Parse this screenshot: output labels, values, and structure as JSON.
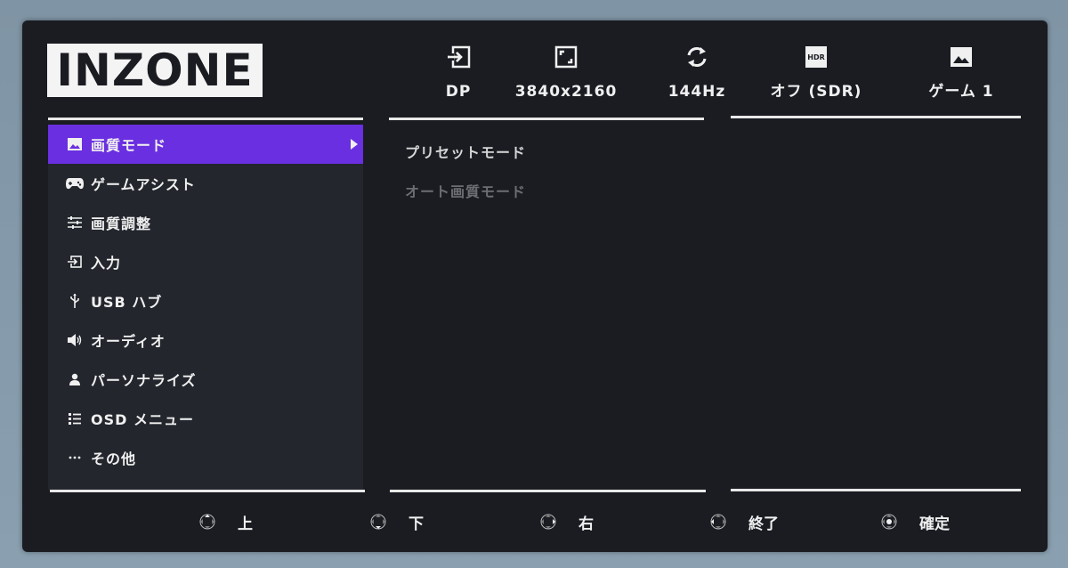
{
  "brand": {
    "logo_text": "INZONE"
  },
  "status": [
    {
      "icon": "input-icon",
      "label": "DP"
    },
    {
      "icon": "resolution-icon",
      "label": "3840x2160"
    },
    {
      "icon": "refresh-rate-icon",
      "label": "144Hz"
    },
    {
      "icon": "hdr-icon",
      "icon_text": "HDR",
      "label": "オフ (SDR)"
    },
    {
      "icon": "picture-mode-icon",
      "label": "ゲーム 1"
    }
  ],
  "menu": {
    "items": [
      {
        "icon": "picture-icon",
        "label": "画質モード",
        "active": true
      },
      {
        "icon": "gamepad-icon",
        "label": "ゲームアシスト"
      },
      {
        "icon": "sliders-icon",
        "label": "画質調整"
      },
      {
        "icon": "input-icon",
        "label": "入力"
      },
      {
        "icon": "usb-icon",
        "label": "USB ハブ"
      },
      {
        "icon": "speaker-icon",
        "label": "オーディオ"
      },
      {
        "icon": "person-icon",
        "label": "パーソナライズ"
      },
      {
        "icon": "list-icon",
        "label": "OSD メニュー"
      },
      {
        "icon": "ellipsis-icon",
        "label": "その他"
      }
    ]
  },
  "submenu": {
    "items": [
      {
        "label": "プリセットモード",
        "enabled": true
      },
      {
        "label": "オート画質モード",
        "enabled": false
      }
    ]
  },
  "footer": [
    {
      "icon": "dpad-up-icon",
      "label": "上"
    },
    {
      "icon": "dpad-down-icon",
      "label": "下"
    },
    {
      "icon": "dpad-right-icon",
      "label": "右"
    },
    {
      "icon": "dpad-left-icon",
      "label": "終了"
    },
    {
      "icon": "dpad-center-icon",
      "label": "確定"
    }
  ],
  "colors": {
    "accent": "#6a2fe0",
    "panel": "#1a1c22",
    "menu_bg": "#23262d"
  }
}
